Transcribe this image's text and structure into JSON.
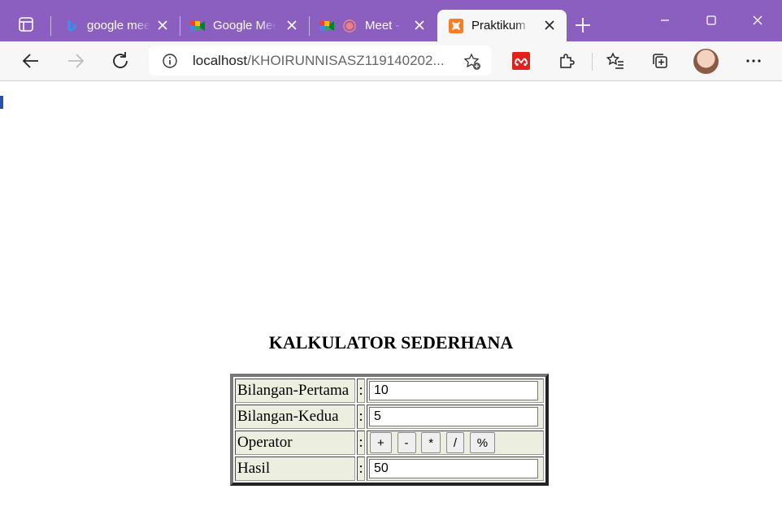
{
  "browser": {
    "tabs": [
      {
        "title": "google meet"
      },
      {
        "title": "Google Meet"
      },
      {
        "title": "Meet -"
      },
      {
        "title": "Praktikum I",
        "active": true
      }
    ],
    "address": {
      "host": "localhost",
      "path": "/KHOIRUNNISASZ119140202..."
    },
    "accent_color": "#8b5fbf"
  },
  "page": {
    "title": "KALKULATOR SEDERHANA",
    "colon": ":",
    "rows": {
      "first_label": "Bilangan-Pertama",
      "first_value": "10",
      "second_label": "Bilangan-Kedua",
      "second_value": "5",
      "operator_label": "Operator",
      "result_label": "Hasil",
      "result_value": "50"
    },
    "operators": [
      "+",
      "-",
      "*",
      "/",
      "%"
    ]
  }
}
